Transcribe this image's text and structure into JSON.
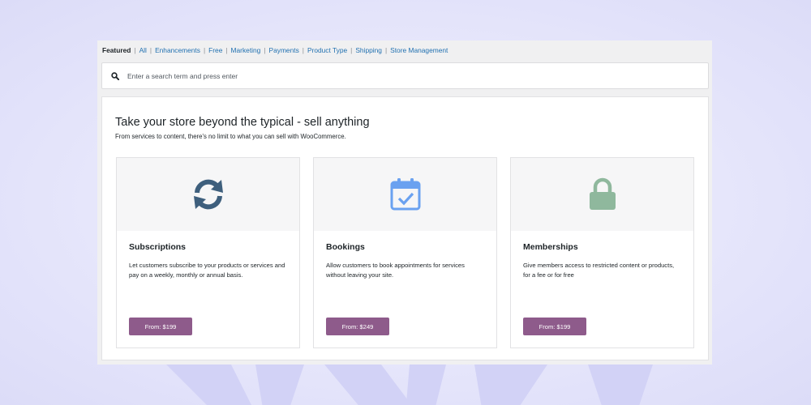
{
  "filters": {
    "active": "Featured",
    "links": [
      "All",
      "Enhancements",
      "Free",
      "Marketing",
      "Payments",
      "Product Type",
      "Shipping",
      "Store Management"
    ]
  },
  "search": {
    "placeholder": "Enter a search term and press enter",
    "value": ""
  },
  "promo": {
    "title": "Take your store beyond the typical - sell anything",
    "subtitle": "From services to content, there's no limit to what you can sell with WooCommerce."
  },
  "cards": [
    {
      "title": "Subscriptions",
      "description": "Let customers subscribe to your products or services and pay on a weekly, monthly or annual basis.",
      "price_label": "From: $199",
      "icon": "refresh-icon",
      "icon_color": "#3e5f7d"
    },
    {
      "title": "Bookings",
      "description": "Allow customers to book appointments for services without leaving your site.",
      "price_label": "From: $249",
      "icon": "calendar-check-icon",
      "icon_color": "#6aa1f0"
    },
    {
      "title": "Memberships",
      "description": "Give members access to restricted content or products, for a fee or for free",
      "price_label": "From: $199",
      "icon": "lock-icon",
      "icon_color": "#8fb89d"
    }
  ],
  "colors": {
    "accent_button": "#8e5b8b",
    "link": "#2271b1",
    "background": "#e3e3fb"
  }
}
